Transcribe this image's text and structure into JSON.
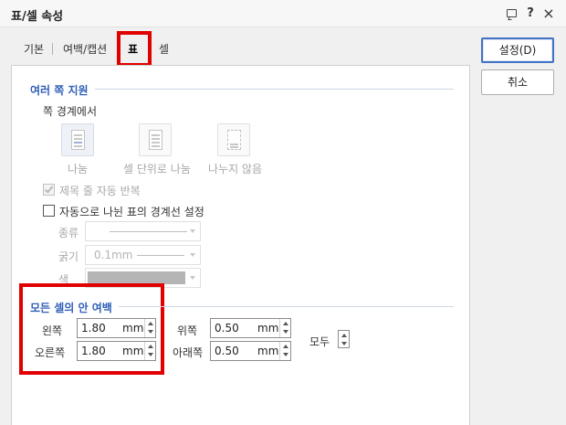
{
  "window": {
    "title": "표/셀 속성",
    "help_icon": "?",
    "close_icon": "×"
  },
  "tabs": [
    {
      "label": "기본"
    },
    {
      "label": "여백/캡션"
    },
    {
      "label": "표",
      "active": true
    },
    {
      "label": "셀"
    }
  ],
  "buttons": {
    "ok_label": "설정(D)",
    "cancel_label": "취소"
  },
  "multipage": {
    "section_title": "여러 쪽 지원",
    "border_label": "쪽 경계에서",
    "options": [
      {
        "label": "나눔",
        "icon": "split-icon",
        "selected": true
      },
      {
        "label": "셀 단위로 나눔",
        "icon": "cell-split-icon"
      },
      {
        "label": "나누지 않음",
        "icon": "no-split-icon"
      }
    ],
    "repeat_title_label": "제목 줄 자동 반복",
    "repeat_title_checked": true,
    "auto_border_label": "자동으로 나뉜 표의 경계선 설정",
    "auto_border_checked": false,
    "type_label": "종류",
    "thickness_label": "굵기",
    "thickness_value": "0.1mm",
    "color_label": "색",
    "color_value": "#b5b5b5"
  },
  "margins": {
    "section_title": "모든 셀의 안 여백",
    "left_label": "왼쪽",
    "left_value": "1.80",
    "right_label": "오른쪽",
    "right_value": "1.80",
    "top_label": "위쪽",
    "top_value": "0.50",
    "bottom_label": "아래쪽",
    "bottom_value": "0.50",
    "unit": "mm",
    "all_label": "모두"
  },
  "colors": {
    "accent": "#2f5fb8",
    "highlight": "#e00000",
    "default_button_border": "#4472c4"
  }
}
